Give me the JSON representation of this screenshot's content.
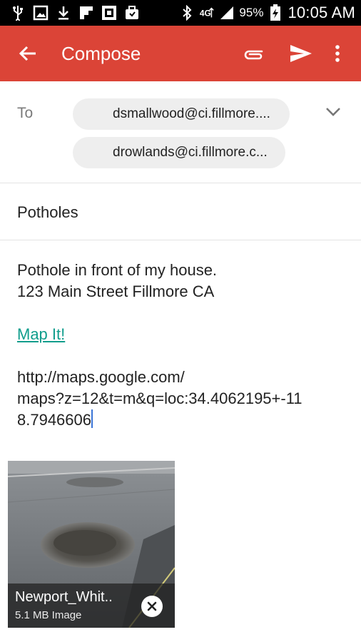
{
  "status_bar": {
    "battery_percent": "95%",
    "time": "10:05 AM",
    "icons": [
      "usb-icon",
      "image-icon",
      "download-icon",
      "flipboard-icon",
      "nfc-tag-icon",
      "briefcase-icon",
      "bluetooth-icon",
      "data-4g-icon",
      "signal-icon",
      "battery-charging-icon"
    ]
  },
  "app_bar": {
    "title": "Compose",
    "color": "#db4437"
  },
  "to": {
    "label": "To",
    "recipients": [
      "dsmallwood@ci.fillmore....",
      "drowlands@ci.fillmore.c..."
    ]
  },
  "subject": {
    "value": "Potholes"
  },
  "body": {
    "line1": "Pothole in front of my house.",
    "line2": "123 Main Street Fillmore CA",
    "link_label": "Map It!",
    "url_line1": "http://maps.google.com/",
    "url_line2": "maps?z=12&t=m&q=loc:34.4062195+-11",
    "url_line3": "8.7946606",
    "link_color": "#0f9d8c"
  },
  "attachment": {
    "name": "Newport_Whit..",
    "size": "5.1 MB Image"
  }
}
